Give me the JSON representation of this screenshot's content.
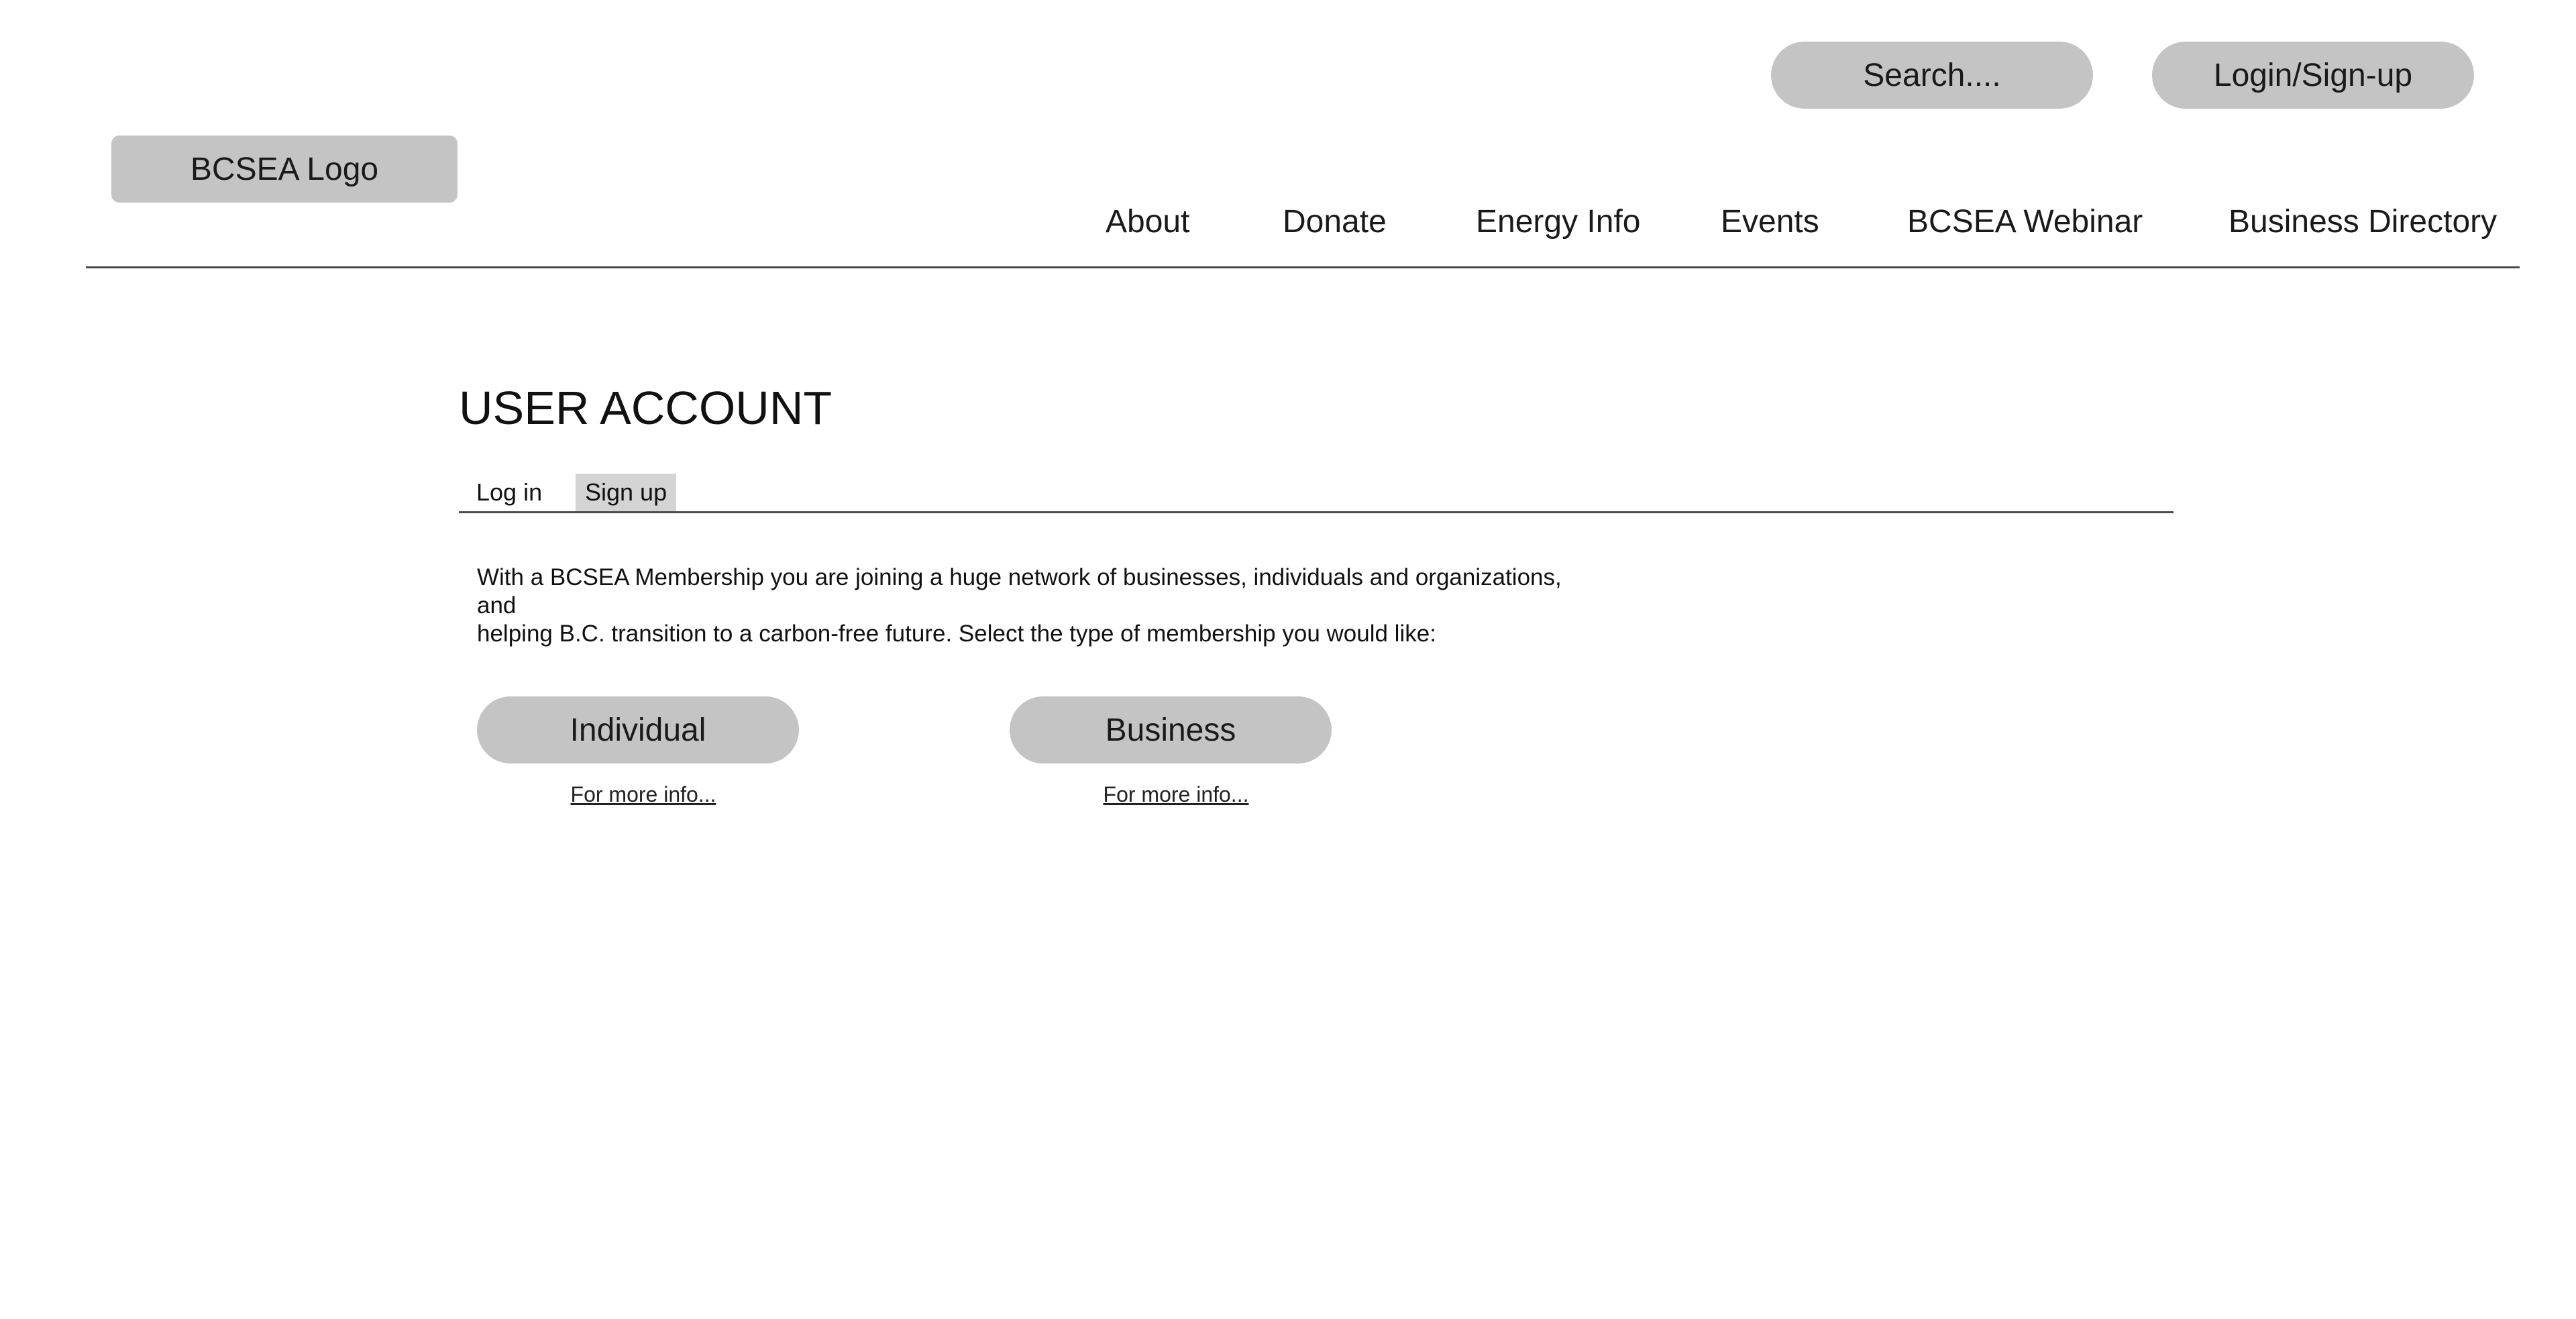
{
  "header": {
    "search_label": "Search....",
    "login_label": "Login/Sign-up",
    "logo_text": "BCSEA Logo",
    "nav": [
      {
        "label": "About"
      },
      {
        "label": "Donate"
      },
      {
        "label": "Energy Info"
      },
      {
        "label": "Events"
      },
      {
        "label": "BCSEA Webinar"
      },
      {
        "label": "Business Directory"
      }
    ]
  },
  "main": {
    "title": "USER ACCOUNT",
    "tabs": [
      {
        "label": "Log in",
        "active": false
      },
      {
        "label": "Sign up",
        "active": true
      }
    ],
    "intro_line1": "With a BCSEA Membership you are joining a huge network of businesses, individuals and organizations, and",
    "intro_line2": "helping B.C. transition to a carbon-free future. Select the type of membership you would like:",
    "membership_options": [
      {
        "label": "Individual",
        "link_text": "For more info..."
      },
      {
        "label": "Business",
        "link_text": "For more info..."
      }
    ]
  },
  "colors": {
    "pill_background": "#c4c4c4",
    "active_tab_background": "#d4d4d4",
    "divider": "#4a4a4a",
    "page_background": "#ffffff"
  }
}
